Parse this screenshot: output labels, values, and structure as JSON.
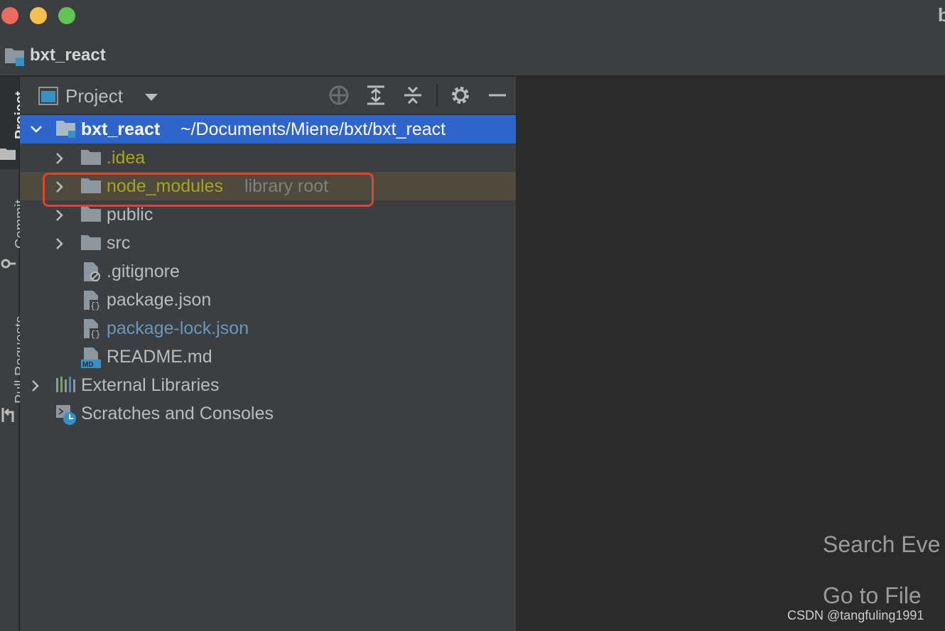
{
  "titlebar": {
    "title_fragment": "b"
  },
  "navbar": {
    "project_name": "bxt_react"
  },
  "left_strip": {
    "tabs": [
      "Project",
      "Commit",
      "Pull Requests"
    ]
  },
  "panel": {
    "title": "Project",
    "toolbar": [
      "locate-icon",
      "expand-all-icon",
      "collapse-all-icon",
      "gear-icon",
      "minimize-icon"
    ]
  },
  "tree": {
    "root_name": "bxt_react",
    "root_path": "~/Documents/Miene/bxt/bxt_react",
    "items": [
      {
        "label": ".idea",
        "kind": "folder",
        "color": "yellow"
      },
      {
        "label": "node_modules",
        "suffix": "library root",
        "kind": "folder",
        "color": "yellow"
      },
      {
        "label": "public",
        "kind": "folder",
        "color": "white"
      },
      {
        "label": "src",
        "kind": "folder",
        "color": "white"
      },
      {
        "label": ".gitignore",
        "kind": "ignore-file",
        "color": "white"
      },
      {
        "label": "package.json",
        "kind": "json-file",
        "color": "white"
      },
      {
        "label": "package-lock.json",
        "kind": "json-file",
        "color": "blue"
      },
      {
        "label": "README.md",
        "kind": "md-file",
        "color": "white"
      }
    ],
    "external_libraries": "External Libraries",
    "scratches": "Scratches and Consoles"
  },
  "editor": {
    "hint_search": "Search Eve",
    "hint_goto": "Go to File"
  },
  "watermark": "CSDN @tangfuling1991",
  "colors": {
    "selection": "#2f65ca",
    "library_row": "#4e4a3e",
    "highlight": "#e2412e",
    "yellow": "#a8a321",
    "blue": "#6897bb"
  }
}
